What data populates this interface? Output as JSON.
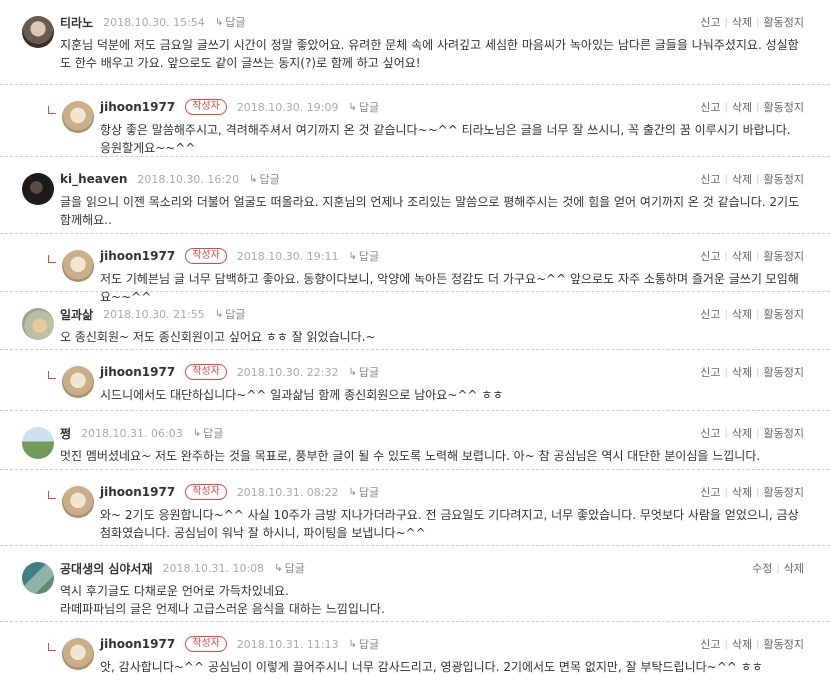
{
  "labels": {
    "reply": "답글",
    "author_badge": "작성자",
    "report": "신고",
    "delete": "삭제",
    "suspend": "활동정지",
    "edit": "수정"
  },
  "comments": [
    {
      "author": "티라노",
      "date": "2018.10.30. 15:54",
      "lines": [
        "지훈님 덕분에 저도 금요일 글쓰기 시간이 정말 좋았어요. 유려한 문체 속에 사려깊고 세심한 마음씨가 녹아있는 남다른 글들을 나눠주셨지요. 성실함도 한수 배우고 가요. 앞으로도 같이 글쓰는 동지(?)로 함께 하고 싶어요!"
      ]
    },
    {
      "author": "jihoon1977",
      "date": "2018.10.30. 19:09",
      "lines": [
        "항상 좋은 말씀해주시고, 격려해주셔서 여기까지 온 것 같습니다~~^^ 티라노님은 글을 너무 잘 쓰시니, 꼭 출간의 꿈 이루시기 바랍니다. 응원할게요~~^^"
      ]
    },
    {
      "author": "ki_heaven",
      "date": "2018.10.30. 16:20",
      "lines": [
        "글을 읽으니 이젠 목소리와 더불어 얼굴도 떠올라요. 지훈님의 언제나 조리있는 말씀으로 평해주시는 것에 힘을 얻어 여기까지 온 것 같습니다. 2기도 함께해요.."
      ]
    },
    {
      "author": "jihoon1977",
      "date": "2018.10.30. 19:11",
      "lines": [
        "저도 기헤븐님 글 너무 담백하고 좋아요. 동향이다보니, 악양에 녹아든 정감도 더 가구요~^^ 앞으로도 자주 소통하며 즐거운 글쓰기 모임해요~~^^"
      ]
    },
    {
      "author": "일과삶",
      "date": "2018.10.30. 21:55",
      "lines": [
        "오 종신회원~ 저도 종신회원이고 싶어요 ㅎㅎ 잘 읽었습니다.~"
      ]
    },
    {
      "author": "jihoon1977",
      "date": "2018.10.30. 22:32",
      "lines": [
        "시드니에서도 대단하십니다~^^ 일과삶님 함께 종신회원으로 남아요~^^ ㅎㅎ"
      ]
    },
    {
      "author": "쩡",
      "date": "2018.10.31. 06:03",
      "lines": [
        "멋진 멤버셨네요~ 저도 완주하는 것을 목표로, 풍부한 글이 될 수 있도록 노력해 보렵니다. 아~ 참 공심님은 역시 대단한 분이심을 느낍니다."
      ]
    },
    {
      "author": "jihoon1977",
      "date": "2018.10.31. 08:22",
      "lines": [
        "와~ 2기도 응원합니다~^^ 사실 10주가 금방 지나가더라구요. 전 금요일도 기다려지고, 너무 좋았습니다. 무엇보다 사람을 얻었으니, 금상첨화였습니다. 공심님이 워낙 잘 하시니, 파이팅을 보냅니다~^^"
      ]
    },
    {
      "author": "공대생의 심야서재",
      "date": "2018.10.31. 10:08",
      "lines": [
        "역시 후기글도 다채로운 언어로 가득차있네요.",
        "라떼파파님의 글은 언제나 고급스러운 음식을 대하는 느낌입니다."
      ]
    },
    {
      "author": "jihoon1977",
      "date": "2018.10.31. 11:13",
      "lines": [
        "앗, 감사합니다~^^ 공심님이 이렇게 끌어주시니 너무 감사드리고, 영광입니다. 2기에서도 면목 없지만, 잘 부탁드립니다~^^ ㅎㅎ"
      ]
    }
  ]
}
